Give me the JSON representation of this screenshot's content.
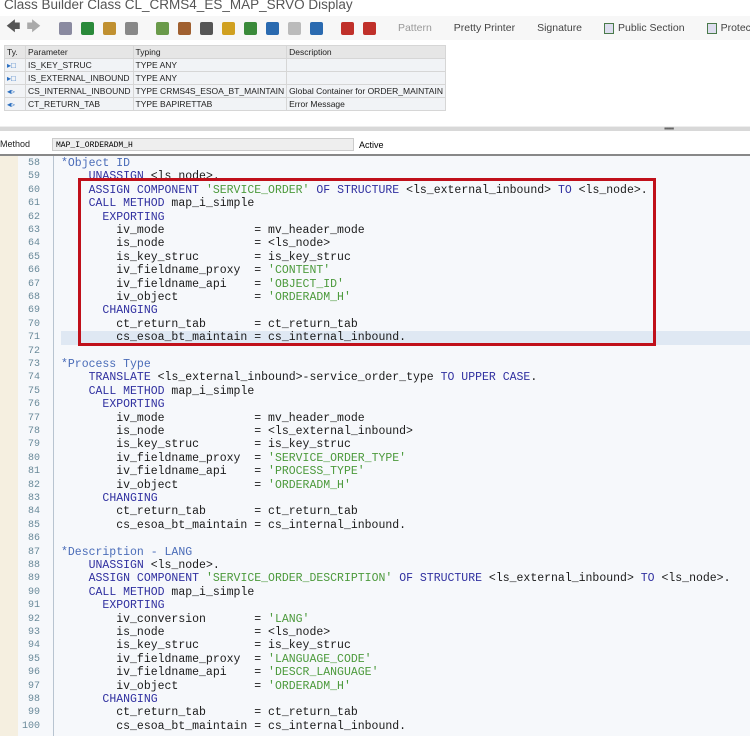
{
  "window": {
    "title": "Class Builder Class CL_CRMS4_ES_MAP_SRVO Display"
  },
  "toolbar": {
    "icons": [
      {
        "name": "back-icon",
        "color": "#555"
      },
      {
        "name": "forward-icon",
        "color": "#aaa"
      },
      {
        "name": "other-object-icon",
        "color": "#8a8aa0"
      },
      {
        "name": "display-change-icon",
        "color": "#2a8a3a"
      },
      {
        "name": "active-inactive-icon",
        "color": "#c09030"
      },
      {
        "name": "check-icon",
        "color": "#888"
      },
      {
        "name": "activate-icon",
        "color": "#6a9a4a"
      },
      {
        "name": "test-icon",
        "color": "#a06030"
      },
      {
        "name": "where-used-icon",
        "color": "#555"
      },
      {
        "name": "object-list-icon",
        "color": "#d0a020"
      },
      {
        "name": "hierarchy-icon",
        "color": "#3a8a3a"
      },
      {
        "name": "navigation-icon",
        "color": "#2a6ab0"
      },
      {
        "name": "fullscreen-icon",
        "color": "#bbb"
      },
      {
        "name": "info-icon",
        "color": "#2a6ab0"
      },
      {
        "name": "breakpoint-icon",
        "color": "#c0302a"
      },
      {
        "name": "external-breakpoint-icon",
        "color": "#c0302a"
      }
    ],
    "buttons": [
      {
        "label": "Pattern",
        "disabled": true
      },
      {
        "label": "Pretty Printer"
      },
      {
        "label": "Signature"
      },
      {
        "label": "Public Section",
        "icon": true
      },
      {
        "label": "Protected",
        "icon": true
      }
    ]
  },
  "params": {
    "headers": [
      "Ty.",
      "Parameter",
      "Typing",
      "Description"
    ],
    "rows": [
      {
        "ty": "▸□",
        "param": "IS_KEY_STRUC",
        "typing": "TYPE ANY",
        "desc": ""
      },
      {
        "ty": "▸□",
        "param": "IS_EXTERNAL_INBOUND",
        "typing": "TYPE ANY",
        "desc": ""
      },
      {
        "ty": "◂▹",
        "param": "CS_INTERNAL_INBOUND",
        "typing": "TYPE CRMS4S_ESOA_BT_MAINTAIN",
        "desc": "Global Container for ORDER_MAINTAIN"
      },
      {
        "ty": "◂▹",
        "param": "CT_RETURN_TAB",
        "typing": "TYPE BAPIRETTAB",
        "desc": "Error Message"
      }
    ]
  },
  "method": {
    "label": "Method",
    "name": "MAP_I_ORDERADM_H",
    "status": "Active"
  },
  "editor": {
    "highlight_line": 71,
    "lines": [
      {
        "n": "58",
        "segs": [
          [
            "c",
            "*Object ID"
          ]
        ]
      },
      {
        "n": "59",
        "segs": [
          [
            "t",
            "    "
          ],
          [
            "k",
            "UNASSIGN"
          ],
          [
            "t",
            " <ls_node>."
          ]
        ]
      },
      {
        "n": "60",
        "segs": [
          [
            "t",
            "    "
          ],
          [
            "k",
            "ASSIGN COMPONENT"
          ],
          [
            "t",
            " "
          ],
          [
            "s",
            "'SERVICE_ORDER'"
          ],
          [
            "t",
            " "
          ],
          [
            "k",
            "OF STRUCTURE"
          ],
          [
            "t",
            " <ls_external_inbound> "
          ],
          [
            "k",
            "TO"
          ],
          [
            "t",
            " <ls_node>."
          ]
        ]
      },
      {
        "n": "61",
        "segs": [
          [
            "t",
            "    "
          ],
          [
            "k",
            "CALL METHOD"
          ],
          [
            "t",
            " map_i_simple"
          ]
        ]
      },
      {
        "n": "62",
        "segs": [
          [
            "t",
            "      "
          ],
          [
            "k",
            "EXPORTING"
          ]
        ]
      },
      {
        "n": "63",
        "segs": [
          [
            "t",
            "        iv_mode             = mv_header_mode"
          ]
        ]
      },
      {
        "n": "64",
        "segs": [
          [
            "t",
            "        is_node             = <ls_node>"
          ]
        ]
      },
      {
        "n": "65",
        "segs": [
          [
            "t",
            "        is_key_struc        = is_key_struc"
          ]
        ]
      },
      {
        "n": "66",
        "segs": [
          [
            "t",
            "        iv_fieldname_proxy  = "
          ],
          [
            "s",
            "'CONTENT'"
          ]
        ]
      },
      {
        "n": "67",
        "segs": [
          [
            "t",
            "        iv_fieldname_api    = "
          ],
          [
            "s",
            "'OBJECT_ID'"
          ]
        ]
      },
      {
        "n": "68",
        "segs": [
          [
            "t",
            "        iv_object           = "
          ],
          [
            "s",
            "'ORDERADM_H'"
          ]
        ]
      },
      {
        "n": "69",
        "segs": [
          [
            "t",
            "      "
          ],
          [
            "k",
            "CHANGING"
          ]
        ]
      },
      {
        "n": "70",
        "segs": [
          [
            "t",
            "        ct_return_tab       = ct_return_tab"
          ]
        ]
      },
      {
        "n": "71",
        "segs": [
          [
            "t",
            "        cs_esoa_bt_maintain = cs_internal_inbound."
          ]
        ]
      },
      {
        "n": "72",
        "segs": []
      },
      {
        "n": "73",
        "segs": [
          [
            "c",
            "*Process Type"
          ]
        ]
      },
      {
        "n": "74",
        "segs": [
          [
            "t",
            "    "
          ],
          [
            "k",
            "TRANSLATE"
          ],
          [
            "t",
            " <ls_external_inbound>-service_order_type "
          ],
          [
            "k",
            "TO UPPER CASE"
          ],
          [
            "t",
            "."
          ]
        ]
      },
      {
        "n": "75",
        "segs": [
          [
            "t",
            "    "
          ],
          [
            "k",
            "CALL METHOD"
          ],
          [
            "t",
            " map_i_simple"
          ]
        ]
      },
      {
        "n": "76",
        "segs": [
          [
            "t",
            "      "
          ],
          [
            "k",
            "EXPORTING"
          ]
        ]
      },
      {
        "n": "77",
        "segs": [
          [
            "t",
            "        iv_mode             = mv_header_mode"
          ]
        ]
      },
      {
        "n": "78",
        "segs": [
          [
            "t",
            "        is_node             = <ls_external_inbound>"
          ]
        ]
      },
      {
        "n": "79",
        "segs": [
          [
            "t",
            "        is_key_struc        = is_key_struc"
          ]
        ]
      },
      {
        "n": "80",
        "segs": [
          [
            "t",
            "        iv_fieldname_proxy  = "
          ],
          [
            "s",
            "'SERVICE_ORDER_TYPE'"
          ]
        ]
      },
      {
        "n": "81",
        "segs": [
          [
            "t",
            "        iv_fieldname_api    = "
          ],
          [
            "s",
            "'PROCESS_TYPE'"
          ]
        ]
      },
      {
        "n": "82",
        "segs": [
          [
            "t",
            "        iv_object           = "
          ],
          [
            "s",
            "'ORDERADM_H'"
          ]
        ]
      },
      {
        "n": "83",
        "segs": [
          [
            "t",
            "      "
          ],
          [
            "k",
            "CHANGING"
          ]
        ]
      },
      {
        "n": "84",
        "segs": [
          [
            "t",
            "        ct_return_tab       = ct_return_tab"
          ]
        ]
      },
      {
        "n": "85",
        "segs": [
          [
            "t",
            "        cs_esoa_bt_maintain = cs_internal_inbound."
          ]
        ]
      },
      {
        "n": "86",
        "segs": []
      },
      {
        "n": "87",
        "segs": [
          [
            "c",
            "*Description - LANG"
          ]
        ]
      },
      {
        "n": "88",
        "segs": [
          [
            "t",
            "    "
          ],
          [
            "k",
            "UNASSIGN"
          ],
          [
            "t",
            " <ls_node>."
          ]
        ]
      },
      {
        "n": "89",
        "segs": [
          [
            "t",
            "    "
          ],
          [
            "k",
            "ASSIGN COMPONENT"
          ],
          [
            "t",
            " "
          ],
          [
            "s",
            "'SERVICE_ORDER_DESCRIPTION'"
          ],
          [
            "t",
            " "
          ],
          [
            "k",
            "OF STRUCTURE"
          ],
          [
            "t",
            " <ls_external_inbound> "
          ],
          [
            "k",
            "TO"
          ],
          [
            "t",
            " <ls_node>."
          ]
        ]
      },
      {
        "n": "90",
        "segs": [
          [
            "t",
            "    "
          ],
          [
            "k",
            "CALL METHOD"
          ],
          [
            "t",
            " map_i_simple"
          ]
        ]
      },
      {
        "n": "91",
        "segs": [
          [
            "t",
            "      "
          ],
          [
            "k",
            "EXPORTING"
          ]
        ]
      },
      {
        "n": "92",
        "segs": [
          [
            "t",
            "        iv_conversion       = "
          ],
          [
            "s",
            "'LANG'"
          ]
        ]
      },
      {
        "n": "93",
        "segs": [
          [
            "t",
            "        is_node             = <ls_node>"
          ]
        ]
      },
      {
        "n": "94",
        "segs": [
          [
            "t",
            "        is_key_struc        = is_key_struc"
          ]
        ]
      },
      {
        "n": "95",
        "segs": [
          [
            "t",
            "        iv_fieldname_proxy  = "
          ],
          [
            "s",
            "'LANGUAGE_CODE'"
          ]
        ]
      },
      {
        "n": "96",
        "segs": [
          [
            "t",
            "        iv_fieldname_api    = "
          ],
          [
            "s",
            "'DESCR_LANGUAGE'"
          ]
        ]
      },
      {
        "n": "97",
        "segs": [
          [
            "t",
            "        iv_object           = "
          ],
          [
            "s",
            "'ORDERADM_H'"
          ]
        ]
      },
      {
        "n": "98",
        "segs": [
          [
            "t",
            "      "
          ],
          [
            "k",
            "CHANGING"
          ]
        ]
      },
      {
        "n": "99",
        "segs": [
          [
            "t",
            "        ct_return_tab       = ct_return_tab"
          ]
        ]
      },
      {
        "n": "100",
        "segs": [
          [
            "t",
            "        cs_esoa_bt_maintain = cs_internal_inbound."
          ]
        ]
      }
    ]
  },
  "colors": {
    "highlight_box": "#c0101a",
    "keyword": "#3030a0",
    "string": "#4c9a3c",
    "comment": "#4a6cb8"
  }
}
